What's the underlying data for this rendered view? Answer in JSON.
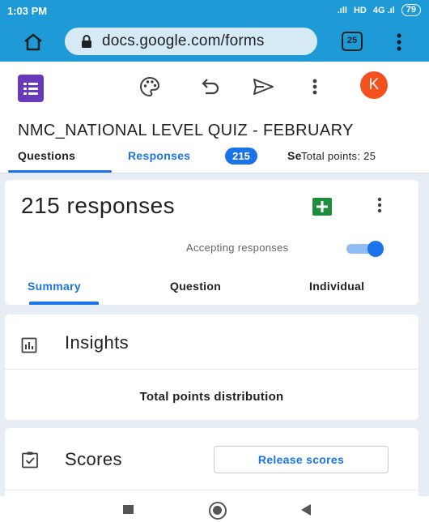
{
  "status_bar": {
    "time": "1:03 PM",
    "signal": ".ıll",
    "hd": "HD",
    "signal_2": "4G .ıl",
    "battery": "79"
  },
  "browser": {
    "url": "docs.google.com/forms",
    "tab_count": "25",
    "icons": [
      "home-icon",
      "lock-icon",
      "more-vert-icon"
    ]
  },
  "form": {
    "title": "NMC_NATIONAL LEVEL QUIZ - FEBRUARY",
    "avatar_initial": "K",
    "toolbar_icons": [
      "palette-icon",
      "undo-icon",
      "send-icon",
      "more-vert-icon"
    ],
    "tabs": {
      "questions": "Questions",
      "responses": "Responses",
      "responses_count": "215",
      "settings": "Settings"
    },
    "total_points": "Total points: 25"
  },
  "responses": {
    "count_label": "215 responses",
    "accepting_label": "Accepting responses",
    "accepting": true,
    "subtabs": {
      "summary": "Summary",
      "question": "Question",
      "individual": "Individual"
    }
  },
  "insights": {
    "title": "Insights",
    "distribution_label": "Total points distribution"
  },
  "scores": {
    "title": "Scores",
    "release_button": "Release scores"
  },
  "colors": {
    "browser_bar": "#1e9ad6",
    "accent": "#1a73e8",
    "forms_purple": "#673ab7",
    "avatar": "#f4511e",
    "sheets_green": "#1e8e3e"
  }
}
